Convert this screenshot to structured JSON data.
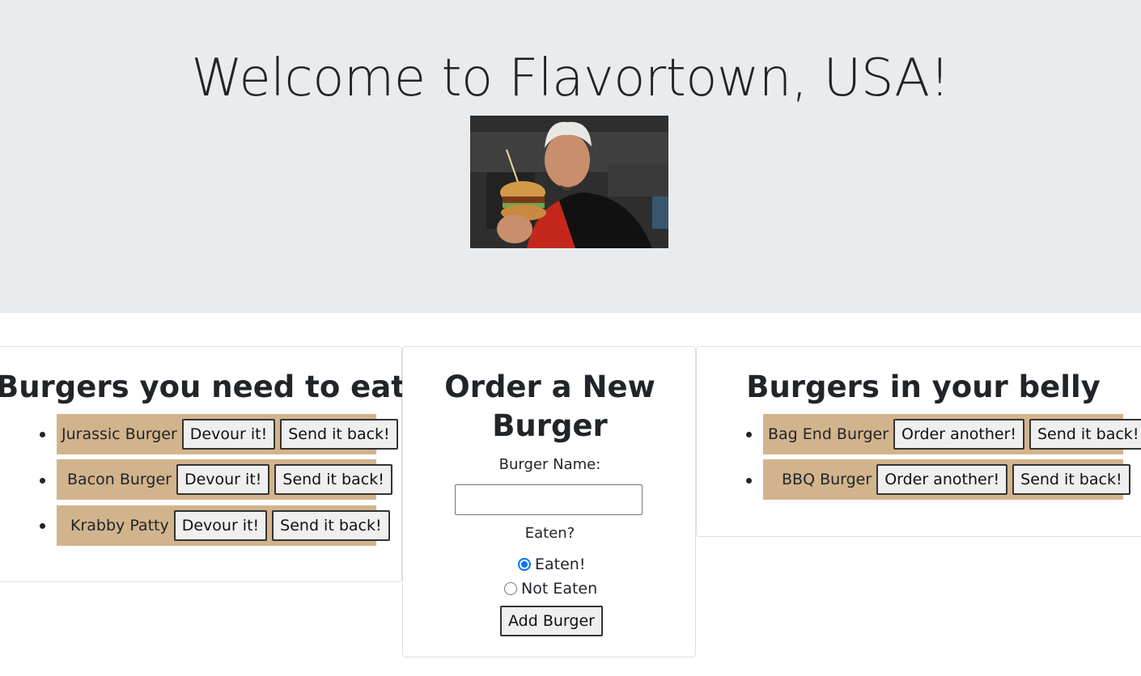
{
  "header": {
    "title": "Welcome to Flavortown, USA!",
    "image_alt": "Chef holding a burger"
  },
  "uneaten": {
    "heading": "Burgers you need to eat",
    "items": [
      {
        "name": "Jurassic Burger",
        "primary_label": "Devour it!",
        "secondary_label": "Send it back!"
      },
      {
        "name": "Bacon Burger",
        "primary_label": "Devour it!",
        "secondary_label": "Send it back!"
      },
      {
        "name": "Krabby Patty",
        "primary_label": "Devour it!",
        "secondary_label": "Send it back!"
      }
    ]
  },
  "order_form": {
    "heading": "Order a New Burger",
    "name_label": "Burger Name:",
    "name_value": "",
    "eaten_label": "Eaten?",
    "options": [
      {
        "label": "Eaten!",
        "selected": true
      },
      {
        "label": "Not Eaten",
        "selected": false
      }
    ],
    "submit_label": "Add Burger"
  },
  "eaten": {
    "heading": "Burgers in your belly",
    "items": [
      {
        "name": "Bag End Burger",
        "primary_label": "Order another!",
        "secondary_label": "Send it back!"
      },
      {
        "name": "BBQ Burger",
        "primary_label": "Order another!",
        "secondary_label": "Send it back!"
      }
    ]
  },
  "colors": {
    "jumbotron_bg": "#e9ecef",
    "burger_item_bg": "#d2b48c",
    "radio_accent": "#0075ff"
  }
}
